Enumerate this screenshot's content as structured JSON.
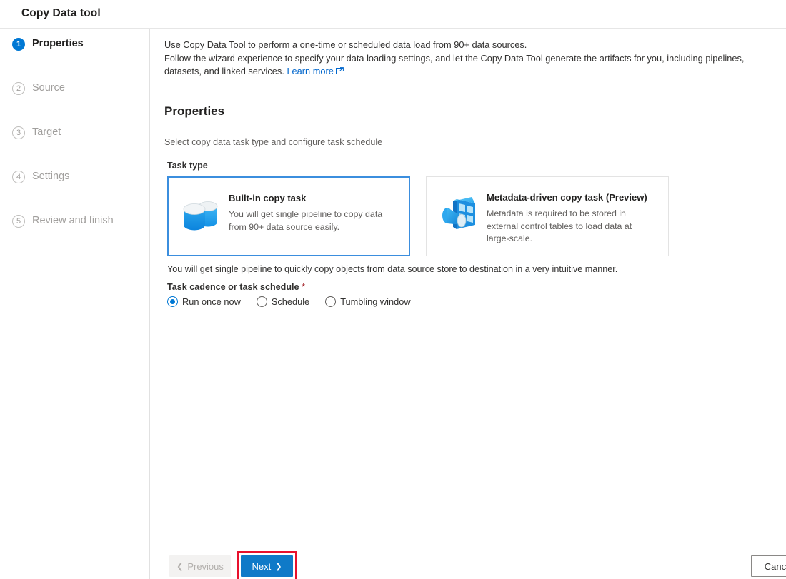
{
  "window": {
    "title": "Copy Data tool"
  },
  "sidebar": {
    "steps": [
      {
        "number": "1",
        "label": "Properties",
        "state": "active"
      },
      {
        "number": "2",
        "label": "Source",
        "state": "inactive"
      },
      {
        "number": "3",
        "label": "Target",
        "state": "inactive"
      },
      {
        "number": "4",
        "label": "Settings",
        "state": "inactive"
      },
      {
        "number": "5",
        "label": "Review and finish",
        "state": "inactive"
      }
    ]
  },
  "main": {
    "intro": {
      "line1": "Use Copy Data Tool to perform a one-time or scheduled data load from 90+ data sources.",
      "line2": "Follow the wizard experience to specify your data loading settings, and let the Copy Data Tool generate the artifacts for you, including pipelines, datasets, and linked services.",
      "link_text": "Learn more",
      "link_icon": "external-link-icon"
    },
    "section_title": "Properties",
    "section_subtitle": "Select copy data task type and configure task schedule",
    "task_type": {
      "label": "Task type",
      "cards": [
        {
          "title": "Built-in copy task",
          "description": "You will get single pipeline to copy data from 90+ data source easily.",
          "icon": "database-cylinders-icon",
          "selected": true
        },
        {
          "title": "Metadata-driven copy task (Preview)",
          "description": "Metadata is required to be stored in external control tables to load data at large-scale.",
          "icon": "metadata-grid-icon",
          "selected": false
        }
      ],
      "note": "You will get single pipeline to quickly copy objects from data source store to destination in a very intuitive manner."
    },
    "cadence": {
      "label": "Task cadence or task schedule",
      "required_marker": "*",
      "options": [
        {
          "label": "Run once now",
          "checked": true
        },
        {
          "label": "Schedule",
          "checked": false
        },
        {
          "label": "Tumbling window",
          "checked": false
        }
      ]
    }
  },
  "footer": {
    "previous_label": "Previous",
    "next_label": "Next",
    "cancel_label": "Cancel",
    "previous_icon": "chevron-left-icon",
    "next_icon": "chevron-right-icon"
  },
  "colors": {
    "accent": "#0078d4",
    "next_button": "#0f7ac8",
    "selected_card_border": "#3b8ede",
    "link": "#0066cc",
    "required_asterisk": "#a4262c",
    "annotation": "#e8112d"
  }
}
